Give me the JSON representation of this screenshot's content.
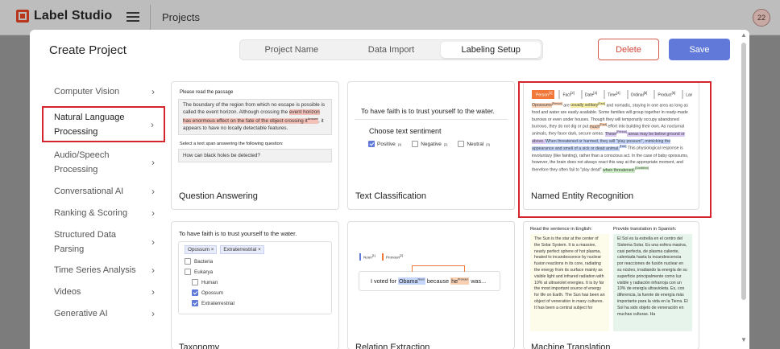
{
  "topbar": {
    "app_name": "Label Studio",
    "crumb": "Projects",
    "user_initials": "22"
  },
  "modal": {
    "title": "Create Project",
    "steps": [
      "Project Name",
      "Data Import",
      "Labeling Setup"
    ],
    "active_step": "Labeling Setup",
    "delete_label": "Delete",
    "save_label": "Save"
  },
  "categories": [
    {
      "label": "Computer Vision"
    },
    {
      "label": "Natural Language Processing",
      "selected": true
    },
    {
      "label": "Audio/Speech Processing"
    },
    {
      "label": "Conversational AI"
    },
    {
      "label": "Ranking & Scoring"
    },
    {
      "label": "Structured Data Parsing"
    },
    {
      "label": "Time Series Analysis"
    },
    {
      "label": "Videos"
    },
    {
      "label": "Generative AI"
    }
  ],
  "templates": {
    "qa": {
      "title": "Question Answering",
      "prompt": "Please read the passage",
      "passage_before": "The boundary of the region from which no escape is possible is called the event horizon. Although crossing the ",
      "passage_highlight": "event horizon has enormous effect on the fate of the object crossing it",
      "passage_tag": "Answer",
      "passage_after": ", it appears to have no locally detectable features.",
      "question_prompt": "Select a text span answering the following question:",
      "question": "How can black holes be detected?"
    },
    "tc": {
      "title": "Text Classification",
      "sentence": "To have faith is to trust yourself to the water.",
      "choose": "Choose text sentiment",
      "options": [
        {
          "label": "Positive",
          "key": "[1]",
          "checked": true
        },
        {
          "label": "Negative",
          "key": "[2]",
          "checked": false
        },
        {
          "label": "Neutral",
          "key": "[3]",
          "checked": false
        }
      ]
    },
    "ner": {
      "title": "Named Entity Recognition",
      "tags": [
        "Person",
        "Fact",
        "Date",
        "Time",
        "Ordinal",
        "Product",
        "Lang"
      ],
      "tag_keys": [
        "[1]",
        "[2]",
        "[3]",
        "[4]",
        "[5]",
        "[6]",
        "[7]"
      ],
      "segments": [
        {
          "t": "Opossums",
          "c": "o"
        },
        {
          "t": "[Person]",
          "c": "o",
          "sup": true
        },
        {
          "t": " are "
        },
        {
          "t": "usually solitary",
          "c": "y"
        },
        {
          "t": "[Fact]",
          "c": "y",
          "sup": true
        },
        {
          "t": " and nomadic, staying in one area as long as food and water are easily available. Some families will group together in ready-made burrows or even under houses. Though they will temporarily occupy abandoned burrows, they do not dig or put "
        },
        {
          "t": "much",
          "c": "o"
        },
        {
          "t": "[Fact]",
          "c": "o",
          "sup": true
        },
        {
          "t": " effort into building their own. As nocturnal animals, they favor dark, secure areas. "
        },
        {
          "t": "These",
          "c": "p"
        },
        {
          "t": "[Person]",
          "c": "p",
          "sup": true
        },
        {
          "t": " areas may be below ground or above. ",
          "c": "p"
        },
        {
          "t": "When threatened or harmed, they will \"play possum\"",
          "c": "b"
        },
        {
          "t": ", mimicking the appearance and smell of a sick or dead animal.",
          "c": "b"
        },
        {
          "t": "[Fact]",
          "c": "b",
          "sup": true
        },
        {
          "t": " This physiological response is involuntary (like fainting), rather than a conscious act. In the case of baby opossums, however, the brain does not always react this way at the appropriate moment, and therefore they often fail to \"play dead\" "
        },
        {
          "t": "when threatened.",
          "c": "g"
        },
        {
          "t": "[Condition]",
          "c": "g",
          "sup": true
        }
      ]
    },
    "tax": {
      "title": "Taxonomy",
      "sentence": "To have faith is to trust yourself to the water.",
      "chips": [
        "Opossum",
        "Extraterrestrial"
      ],
      "items": [
        {
          "label": "Bacteria",
          "level": 1,
          "checked": false
        },
        {
          "label": "Eukarya",
          "level": 1,
          "checked": false
        },
        {
          "label": "Human",
          "level": 2,
          "checked": false
        },
        {
          "label": "Opossum",
          "level": 2,
          "checked": true
        },
        {
          "label": "Extraterrestrial",
          "level": 2,
          "checked": true
        }
      ]
    },
    "rel": {
      "title": "Relation Extraction",
      "tags": [
        {
          "label": "Noun",
          "key": "[1]"
        },
        {
          "label": "Pronoun",
          "key": "[2]"
        }
      ],
      "text_before": "I voted for ",
      "noun": "Obama",
      "noun_tag": "Noun",
      "text_mid": " because ",
      "pronoun": "he",
      "pronoun_tag": "Pronoun",
      "text_after": " was..."
    },
    "mt": {
      "title": "Machine Translation",
      "en_header": "Read the sentence in English:",
      "es_header": "Provide translation in Spanish:",
      "en_text": "The Sun is the star at the center of the Solar System. It is a massive, nearly perfect sphere of hot plasma, heated to incandescence by nuclear fusion reactions in its core, radiating the energy from its surface mainly as visible light and infrared radiation with 10% at ultraviolet energies. It is by far the most important source of energy for life on Earth. The Sun has been an object of veneration in many cultures. It has been a central subject for",
      "es_text": "El Sol es la estrella en el centro del Sistema Solar. Es una esfera masiva, casi perfecta, de plasma caliente, calentada hasta la incandescencia por reacciones de fusión nuclear en su núcleo, irradiando la energía de su superficie principalmente como luz visible y radiación infrarroja con un 10% de energía ultravioleta. Es, con diferencia, la fuente de energía más importante para la vida en la Tierra. El Sol ha sido objeto de veneración en muchas culturas. Ha"
    }
  },
  "colors": {
    "brand": "#b8371c",
    "primary": "#617ada",
    "danger": "#d2473a",
    "selection_frame": "#d5252c"
  }
}
